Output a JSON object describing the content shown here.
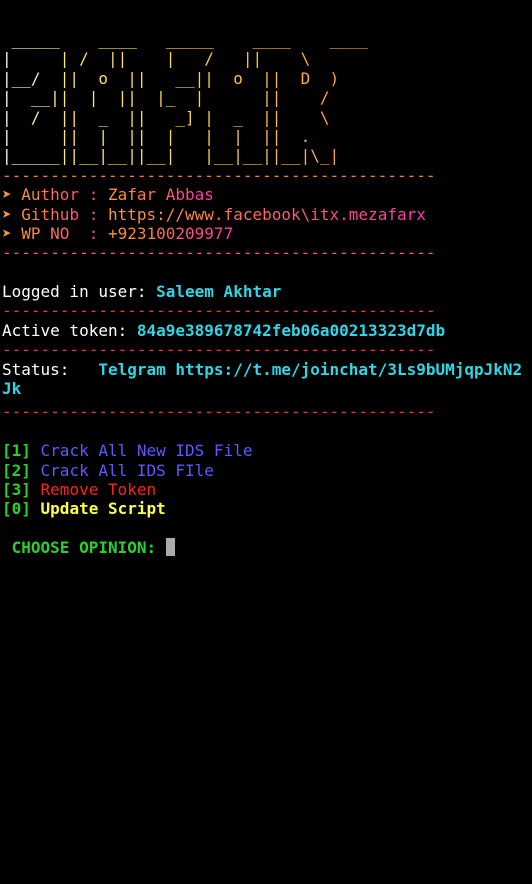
{
  "banner": {
    "lines": [
      " _____    ____   _____    ____    ____",
      "|     | /  ||    |   /   ||    \\",
      "|__/  ||  o  ||   __||  o  ||  D  )",
      "|  __||  |  ||  |_  |      ||    /",
      "|  /  ||  _  ||   _] |  _  ||    \\",
      "|     ||  |  ||  |   |  |  ||  .  ",
      "|_____||__|__||__|   |__|__||__|\\_|"
    ],
    "separator": "---------------------------------------------"
  },
  "info": {
    "arrow": "➤",
    "author_label": " Author : ",
    "author_value": "Zafar Abbas",
    "github_label": " Github : ",
    "github_value": "https://www.facebook\\itx.mezafarx",
    "wp_label": " WP NO  : ",
    "wp_value": "+923100209977"
  },
  "session": {
    "user_label": "Logged in user: ",
    "user_value": "Saleem Akhtar",
    "token_label": "Active token: ",
    "token_value": "84a9e389678742feb06a00213323d7db",
    "status_label": "Status:   ",
    "status_value": "Telgram https://t.me/joinchat/3Ls9bUMjqpJkN2Jk"
  },
  "menu": [
    {
      "key": "[1]",
      "label": " Crack All New IDS File",
      "color": "#5a5aff"
    },
    {
      "key": "[2]",
      "label": " Crack All IDS FIle",
      "color": "#5a5aff"
    },
    {
      "key": "[3]",
      "label": " Remove Token",
      "color": "#ff2020"
    },
    {
      "key": "[0]",
      "label": " Update Script",
      "color": "#ffff40"
    }
  ],
  "prompt": {
    "text": " CHOOSE OPINION: "
  },
  "colors": {
    "background": "#000000",
    "key_green": "#29d129",
    "value_cyan": "#2fd6e6",
    "separator_red": "#ff3030"
  }
}
